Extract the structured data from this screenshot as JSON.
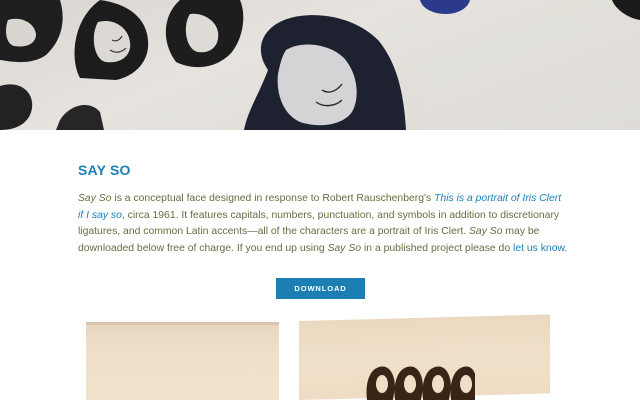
{
  "title": "SAY SO",
  "description": {
    "part1": "Say So",
    "part2": " is a conceptual face designed in response to Robert Rauschenberg's ",
    "part3": "This is a portrait of Iris Clert if I say so",
    "part4": ", circa 1961. It features capitals, numbers, punctuation, and symbols in addition to discretionary ligatures, and common Latin accents—all of the characters are a portrait of Iris Clert. ",
    "part5": "Say So",
    "part6": " may be downloaded below free of charge. If you end up using ",
    "part7": "Say So",
    "part8": " in a published project please do ",
    "link": "let us know",
    "part9": "."
  },
  "download_label": "DOWNLOAD",
  "colors": {
    "accent": "#1b7fb4",
    "body_text": "#6b6b42",
    "ink": "#3a2416",
    "paper": "#efdfc8"
  }
}
